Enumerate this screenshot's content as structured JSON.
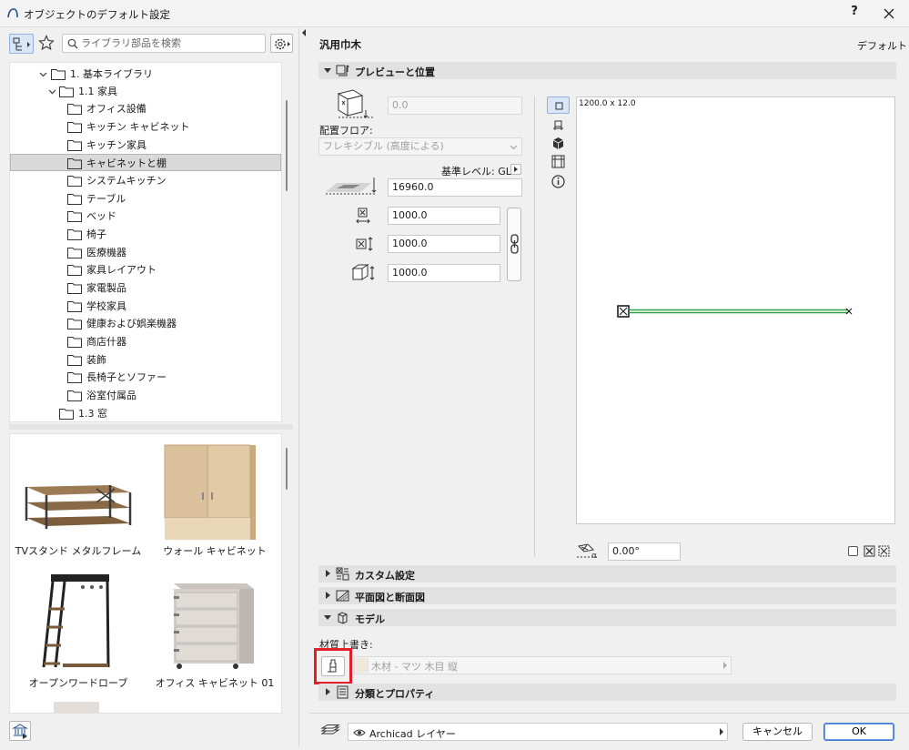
{
  "window": {
    "title": "オブジェクトのデフォルト設定",
    "help_label": "?",
    "close_icon": "close-icon"
  },
  "library": {
    "search_placeholder": "ライブラリ部品を検索",
    "tree": [
      {
        "label": "1. 基本ライブラリ",
        "level": 1,
        "expanded": true
      },
      {
        "label": "1.1 家具",
        "level": 2,
        "expanded": true
      },
      {
        "label": "オフィス設備",
        "level": 3
      },
      {
        "label": "キッチン キャビネット",
        "level": 3
      },
      {
        "label": "キッチン家具",
        "level": 3
      },
      {
        "label": "キャビネットと棚",
        "level": 3,
        "selected": true
      },
      {
        "label": "システムキッチン",
        "level": 3
      },
      {
        "label": "テーブル",
        "level": 3
      },
      {
        "label": "ベッド",
        "level": 3
      },
      {
        "label": "椅子",
        "level": 3
      },
      {
        "label": "医療機器",
        "level": 3
      },
      {
        "label": "家具レイアウト",
        "level": 3
      },
      {
        "label": "家電製品",
        "level": 3
      },
      {
        "label": "学校家具",
        "level": 3
      },
      {
        "label": "健康および娯楽機器",
        "level": 3
      },
      {
        "label": "商店什器",
        "level": 3
      },
      {
        "label": "装飾",
        "level": 3
      },
      {
        "label": "長椅子とソファー",
        "level": 3
      },
      {
        "label": "浴室付属品",
        "level": 3
      },
      {
        "label": "1.3 窓",
        "level": 2
      }
    ],
    "thumbnails": [
      {
        "label": "TVスタンド メタルフレーム"
      },
      {
        "label": "ウォール キャビネット"
      },
      {
        "label": "オープンワードローブ"
      },
      {
        "label": "オフィス キャビネット 01"
      }
    ]
  },
  "object": {
    "name": "汎用巾木",
    "default_label": "デフォルト"
  },
  "sections": {
    "preview": "プレビューと位置",
    "custom": "カスタム設定",
    "floorplan": "平面図と断面図",
    "model": "モデル",
    "classification": "分類とプロパティ"
  },
  "position": {
    "top_offset": "0.0",
    "home_floor_label": "配置フロア:",
    "home_floor_value": "フレキシブル (高度による)",
    "ref_level_label": "基準レベル: GL",
    "elevation": "16960.0",
    "width": "1000.0",
    "depth": "1000.0",
    "height": "1000.0"
  },
  "preview": {
    "dimension_text": "1200.0 x 12.0",
    "angle": "0.00°",
    "line_color": "#2ea043"
  },
  "model": {
    "material_override_label": "材質上書き:",
    "material_value": "木材 - マツ 木目 縦"
  },
  "footer": {
    "layer_value": "Archicad レイヤー",
    "cancel_label": "キャンセル",
    "ok_label": "OK"
  }
}
